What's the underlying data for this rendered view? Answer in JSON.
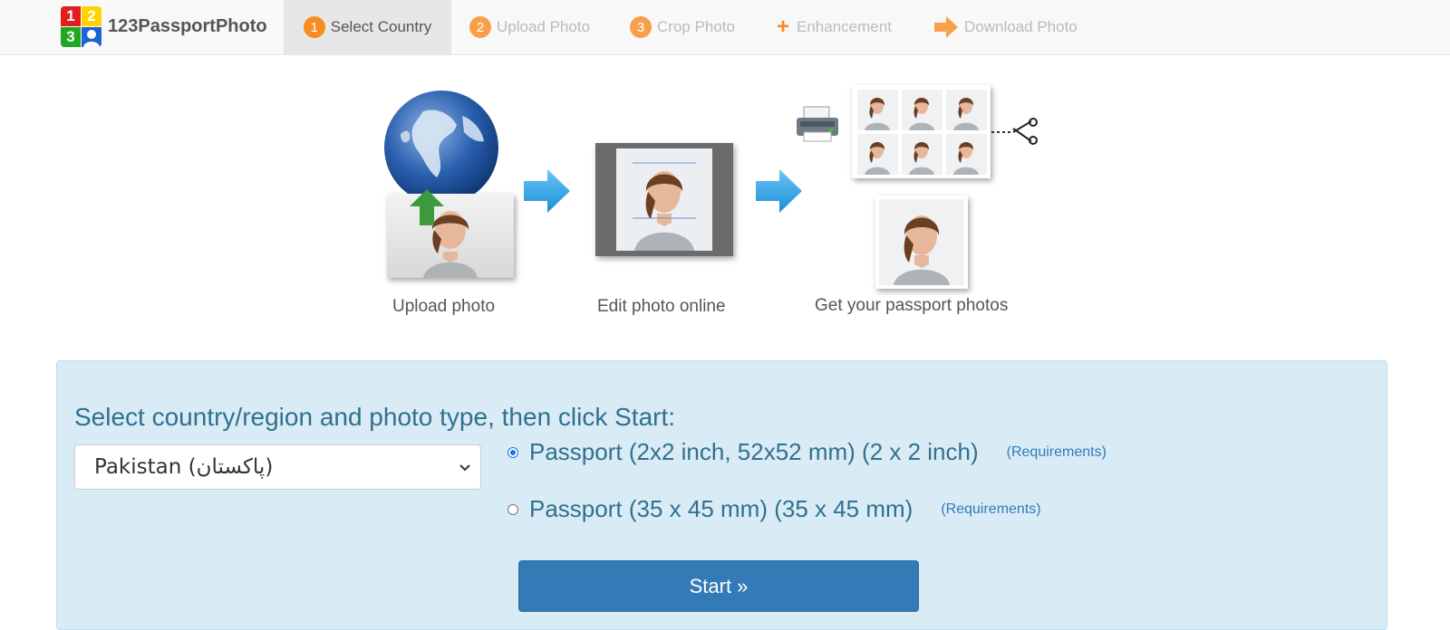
{
  "brand": {
    "name": "123PassportPhoto",
    "logo_digits": [
      "1",
      "2",
      "3"
    ]
  },
  "steps": [
    {
      "number": "1",
      "label": "Select Country",
      "active": true
    },
    {
      "number": "2",
      "label": "Upload Photo",
      "active": false
    },
    {
      "number": "3",
      "label": "Crop Photo",
      "active": false
    },
    {
      "icon": "plus-icon",
      "label": "Enhancement",
      "active": false
    },
    {
      "icon": "arrow-right-icon",
      "label": "Download Photo",
      "active": false
    }
  ],
  "illustration": {
    "captions": [
      "Upload photo",
      "Edit photo online",
      "Get your passport photos"
    ]
  },
  "form": {
    "prompt": "Select country/region and photo type, then click Start:",
    "country_selected": "Pakistan (پاکستان)",
    "photo_types": [
      {
        "label": "Passport (2x2 inch, 52x52 mm) (2 x 2 inch)",
        "link": "(Requirements)",
        "selected": true
      },
      {
        "label": "Passport (35 x 45 mm) (35 x 45 mm)",
        "link": "(Requirements)",
        "selected": false
      }
    ],
    "start_label": "Start »"
  },
  "colors": {
    "accent_orange": "#f58d1f",
    "panel_bg": "#d9ecf6",
    "panel_text": "#31708f",
    "button_blue": "#337ab7"
  }
}
